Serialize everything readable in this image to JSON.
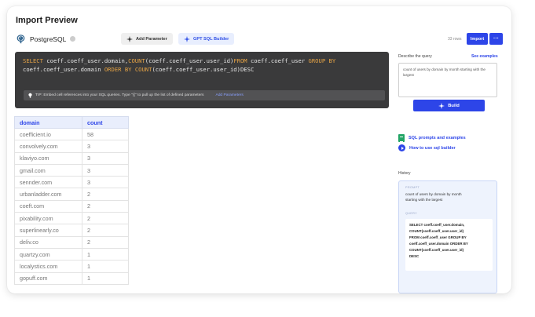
{
  "title": "Import Preview",
  "connection": {
    "name": "PostgreSQL",
    "icon": "postgresql-elephant-icon"
  },
  "toolbar": {
    "add_parameter_label": "Add Parameter",
    "gpt_builder_label": "GPT SQL Builder",
    "rows_count": "33 rows",
    "import_label": "Import",
    "more_label": "···"
  },
  "editor": {
    "line1": [
      {
        "t": "SELECT ",
        "k": true
      },
      {
        "t": "coeff.coeff_user.domain,",
        "k": false
      },
      {
        "t": "COUNT",
        "k": true
      },
      {
        "t": "(coeff.coeff_user.user_id)",
        "k": false
      },
      {
        "t": "FROM ",
        "k": true
      },
      {
        "t": "coeff.coeff_user ",
        "k": false
      },
      {
        "t": "GROUP BY",
        "k": true
      }
    ],
    "line2": [
      {
        "t": "coeff.coeff_user.domain ",
        "k": false
      },
      {
        "t": "ORDER BY ",
        "k": true
      },
      {
        "t": "COUNT",
        "k": true
      },
      {
        "t": "(coeff.coeff_user.user_id)DESC",
        "k": false
      }
    ],
    "tip_text": "TIP: Embed cell references into your SQL queries. Type \"{{\" to pull up the list of defined parameters",
    "tip_link": "Add Parameters"
  },
  "table": {
    "headers": [
      "domain",
      "count"
    ],
    "rows": [
      [
        "coefficient.io",
        "58"
      ],
      [
        "convolvely.com",
        "3"
      ],
      [
        "klaviyo.com",
        "3"
      ],
      [
        "gmail.com",
        "3"
      ],
      [
        "sennder.com",
        "3"
      ],
      [
        "urbanladder.com",
        "2"
      ],
      [
        "coeft.com",
        "2"
      ],
      [
        "pixability.com",
        "2"
      ],
      [
        "superlinearly.co",
        "2"
      ],
      [
        "deliv.co",
        "2"
      ],
      [
        "quartzy.com",
        "1"
      ],
      [
        "localystics.com",
        "1"
      ],
      [
        "gopuff.com",
        "1"
      ]
    ]
  },
  "gpt_panel": {
    "describe_label": "Describe the query",
    "see_examples": "See examples",
    "describe_value": "count of users by domain by month starting with the largest",
    "build_label": "Build",
    "sql_prompts_link": "SQL prompts and examples",
    "how_to_link": "How to use sql builder",
    "history_label": "History",
    "history": {
      "prompt_label": "PROMPT",
      "prompt": "count of users by domain by month starting with the largest",
      "query_label": "QUERY",
      "query_lines": [
        "SELECT coeff.coeff_user.domain,",
        "COUNT(coeff.coeff_user.user_id)",
        "FROM coeff.coeff_user GROUP BY",
        "coeff.coeff_user.domain ORDER BY",
        "COUNT(coeff.coeff_user.user_id)",
        "DESC"
      ]
    }
  },
  "colors": {
    "accent": "#2d45e8",
    "editor_bg": "#3a3a3b",
    "keyword": "#e5a345",
    "sheets_green": "#23a566"
  }
}
